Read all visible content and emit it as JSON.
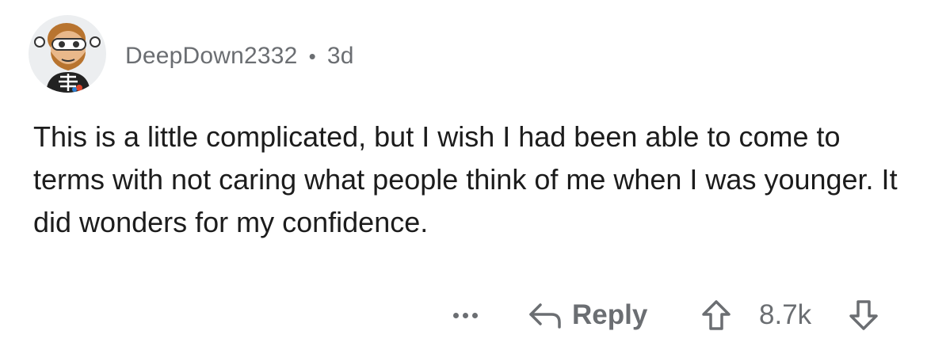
{
  "comment": {
    "username": "DeepDown2332",
    "separator": "•",
    "age": "3d",
    "text": "This is a little complicated, but I wish I had been able to come to terms with not caring what people think of me when I was younger. It did wonders for my confidence."
  },
  "actions": {
    "more_icon": "more-icon",
    "reply_icon": "reply-arrow-icon",
    "reply_label": "Reply",
    "upvote_icon": "upvote-arrow-icon",
    "score": "8.7k",
    "downvote_icon": "downvote-arrow-icon"
  },
  "colors": {
    "text": "#1c1c1c",
    "muted": "#6b6e72",
    "avatar_bg": "#eceef0"
  }
}
